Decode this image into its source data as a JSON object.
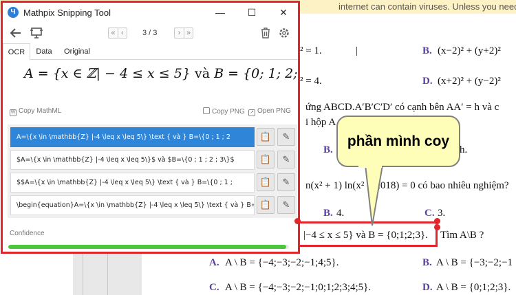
{
  "document": {
    "banner_text": "internet can contain viruses. Unless you need to edit, it's s",
    "lines": [
      {
        "id": "l1a",
        "text": "² = 1."
      },
      {
        "id": "l1b",
        "text": "|"
      },
      {
        "id": "l1opt",
        "text": "B."
      },
      {
        "id": "l1eq",
        "text": "(x−2)² + (y+2)²"
      },
      {
        "id": "l2a",
        "text": "² = 4."
      },
      {
        "id": "l2opt",
        "text": "D."
      },
      {
        "id": "l2eq",
        "text": "(x+2)² + (y−2)²"
      },
      {
        "id": "l3",
        "text": "ứng  ABCD.A′B′C′D′  có cạnh bên  AA′ = h  và c"
      },
      {
        "id": "l4",
        "text": "i hộp  A"
      },
      {
        "id": "l5opt",
        "text": "B."
      },
      {
        "id": "l5b",
        "text": "h."
      },
      {
        "id": "l6",
        "text": "n(x² + 1) ln(x² − 2018) = 0  có bao nhiêu nghiệm?"
      },
      {
        "id": "l7opt",
        "text": "B."
      },
      {
        "id": "l7val",
        "text": "4."
      },
      {
        "id": "l7opt2",
        "text": "C."
      },
      {
        "id": "l7val2",
        "text": "3."
      },
      {
        "id": "l8a",
        "text": "|−4 ≤ x ≤ 5}  và  B = {0;1;2;3}."
      },
      {
        "id": "l8b",
        "text": "Tìm A\\B ?"
      },
      {
        "id": "l9opt",
        "text": "A."
      },
      {
        "id": "l9eq",
        "text": "A \\ B = {−4;−3;−2;−1;4;5}."
      },
      {
        "id": "l9opt2",
        "text": "B."
      },
      {
        "id": "l9eq2",
        "text": "A \\ B = {−3;−2;−1"
      },
      {
        "id": "l10opt",
        "text": "C."
      },
      {
        "id": "l10eq",
        "text": "A \\ B = {−4;−3;−2;−1;0;1;2;3;4;5}."
      },
      {
        "id": "l10opt2",
        "text": "D."
      },
      {
        "id": "l10eq2",
        "text": "A \\ B = {0;1;2;3}."
      }
    ]
  },
  "window": {
    "title": "Mathpix Snipping Tool",
    "logo_glyph": "Ч",
    "controls": {
      "minimize": "—",
      "maximize": "☐",
      "close": "✕"
    }
  },
  "toolbar": {
    "page_indicator": "3 / 3"
  },
  "tabs": [
    {
      "label": "OCR",
      "active": true
    },
    {
      "label": "Data",
      "active": false
    },
    {
      "label": "Original",
      "active": false
    }
  ],
  "preview": {
    "part1": "A = {x ∈ ℤ| − 4 ≤ x ≤ 5}",
    "va": " và ",
    "part2": "B = {0; 1; 2; 3}"
  },
  "copy_actions": {
    "copy_mathml": "Copy MathML",
    "copy_png": "Copy PNG",
    "open_png": "Open PNG"
  },
  "results": [
    {
      "text": "A=\\{x \\in \\mathbb{Z} |-4 \\leq x \\leq 5\\} \\text { và } B=\\{0 ; 1 ; 2",
      "selected": true
    },
    {
      "text": "$A=\\{x \\in \\mathbb{Z} |-4 \\leq x \\leq 5\\}$ và $B=\\{0 ; 1 ; 2 ; 3\\}$",
      "selected": false
    },
    {
      "text": "$$A=\\{x \\in \\mathbb{Z} |-4 \\leq x \\leq 5\\} \\text { và } B=\\{0 ; 1 ;",
      "selected": false
    },
    {
      "text": "\\begin{equation}A=\\{x \\in \\mathbb{Z} |-4 \\leq x \\leq 5\\} \\text { và } B=\\{0 ; 1 ;",
      "selected": false
    }
  ],
  "confidence": {
    "label": "Confidence",
    "fraction": 0.99
  },
  "annotation": {
    "callout_text": "phần mình coy"
  },
  "colors": {
    "accent_red": "#e0262b",
    "selected_blue": "#2f85d8",
    "confidence_green": "#4cc73d",
    "callout_yellow": "#fffeb8"
  }
}
